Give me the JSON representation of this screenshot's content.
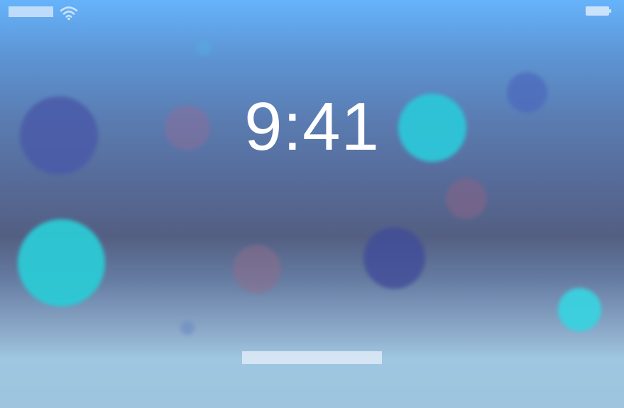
{
  "lock_screen": {
    "time": "9:41",
    "icons": {
      "wifi": "wifi-icon",
      "battery": "battery-icon"
    }
  },
  "colors": {
    "sky_top": "#66b3fb",
    "sky_mid": "#535f82",
    "sky_bottom": "#9ec4de",
    "clock_text": "#ffffff",
    "bubble_teal": "#2dc6d8",
    "bubble_indigo": "#4a5aa8",
    "bubble_mauve": "#8a6e9a"
  }
}
